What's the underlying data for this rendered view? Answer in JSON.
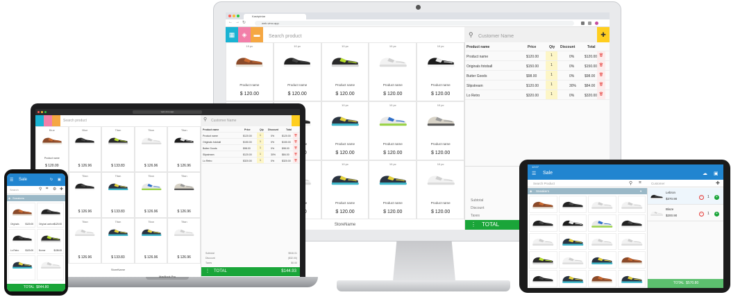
{
  "colors": {
    "green": "#1aa539",
    "cyan": "#1ab3d3",
    "pink": "#f27fa9",
    "orange": "#f5a742",
    "yellow": "#ffce1f",
    "blue": "#2185d0",
    "grey": "#f0f0f0"
  },
  "monitor": {
    "browser_tab": "Kasirpintar",
    "url": "web.vimo.app",
    "search_placeholder": "Search product",
    "customer_placeholder": "Customer Name",
    "products": [
      {
        "variants": "10 pc",
        "name": "Product name",
        "price": "$ 120.00",
        "shoe": "brown"
      },
      {
        "variants": "10 pc",
        "name": "Product name",
        "price": "$ 120.00",
        "shoe": "black"
      },
      {
        "variants": "10 pc",
        "name": "Product name",
        "price": "$ 120.00",
        "shoe": "lime"
      },
      {
        "variants": "10 pc",
        "name": "Product name",
        "price": "$ 120.00",
        "shoe": "white"
      },
      {
        "variants": "10 pc",
        "name": "Product name",
        "price": "$ 120.00",
        "shoe": "blackwhite"
      },
      {
        "variants": "10 pc",
        "name": "Product name",
        "price": "$ 120.00",
        "shoe": "brown"
      },
      {
        "variants": "10 pc",
        "name": "Product name",
        "price": "$ 120.00",
        "shoe": "black"
      },
      {
        "variants": "10 pc",
        "name": "Product name",
        "price": "$ 120.00",
        "shoe": "multi"
      },
      {
        "variants": "10 pc",
        "name": "Product name",
        "price": "$ 120.00",
        "shoe": "blue"
      },
      {
        "variants": "10 pc",
        "name": "Product name",
        "price": "$ 120.00",
        "shoe": "beige"
      },
      {
        "variants": "",
        "name": "Product name",
        "price": "$ 120.00",
        "shoe": "lime"
      },
      {
        "variants": "10 pc",
        "name": "Product name",
        "price": "$ 120.00",
        "shoe": "white"
      },
      {
        "variants": "10 pc",
        "name": "Product name",
        "price": "$ 120.00",
        "shoe": "multi"
      },
      {
        "variants": "10 pc",
        "name": "Product name",
        "price": "$ 120.00",
        "shoe": "multi"
      },
      {
        "variants": "10 pc",
        "name": "Product name",
        "price": "$ 120.00",
        "shoe": "white"
      }
    ],
    "cart_headers": [
      "Product name",
      "Price",
      "Qty",
      "Discount",
      "Total"
    ],
    "cart_rows": [
      {
        "name": "Product name",
        "price": "$120.00",
        "qty": "1",
        "discount": "0%",
        "total": "$120.00"
      },
      {
        "name": "Originals fotoball",
        "price": "$150.00",
        "qty": "1",
        "discount": "0%",
        "total": "$150.00"
      },
      {
        "name": "Butter Goods",
        "price": "$98.00",
        "qty": "1",
        "discount": "0%",
        "total": "$98.00"
      },
      {
        "name": "Slipstream",
        "price": "$120.00",
        "qty": "1",
        "discount": "30%",
        "total": "$84.00"
      },
      {
        "name": "Lo Retro",
        "price": "$320.00",
        "qty": "1",
        "discount": "0%",
        "total": "$320.00"
      }
    ],
    "subtotal_label": "Subtotal",
    "discount_label": "Discount",
    "taxes_label": "Taxes",
    "total_label": "TOTAL",
    "store_name": "StoreName"
  },
  "laptop": {
    "url": "web.vimo.app",
    "search_placeholder": "Search product",
    "customer_placeholder": "Customer Name",
    "products": [
      {
        "variants": "Blue",
        "name": "Product name",
        "price": "$ 120.00",
        "shoe": "brown"
      },
      {
        "variants": "Blue",
        "name": "",
        "price": "$ 126.96",
        "shoe": "black"
      },
      {
        "variants": "Titan",
        "name": "",
        "price": "$ 133.83",
        "shoe": "lime"
      },
      {
        "variants": "Titan",
        "name": "",
        "price": "$ 126.96",
        "shoe": "white"
      },
      {
        "variants": "Titan",
        "name": "",
        "price": "$ 126.96",
        "shoe": "blackwhite"
      },
      {
        "variants": "Titan",
        "name": "",
        "price": "$ 126.96",
        "shoe": "brown"
      },
      {
        "variants": "Titan",
        "name": "",
        "price": "$ 126.96",
        "shoe": "black"
      },
      {
        "variants": "Titan",
        "name": "",
        "price": "$ 133.83",
        "shoe": "multi"
      },
      {
        "variants": "Titan",
        "name": "",
        "price": "$ 126.96",
        "shoe": "blue"
      },
      {
        "variants": "Titan",
        "name": "",
        "price": "$ 126.96",
        "shoe": "beige"
      },
      {
        "variants": "Titan",
        "name": "",
        "price": "$ 126.96",
        "shoe": "lime"
      },
      {
        "variants": "Titan",
        "name": "",
        "price": "$ 126.96",
        "shoe": "white"
      },
      {
        "variants": "Titan",
        "name": "",
        "price": "$ 133.83",
        "shoe": "multi"
      },
      {
        "variants": "Titan",
        "name": "",
        "price": "$ 126.96",
        "shoe": "multi"
      },
      {
        "variants": "Titan",
        "name": "",
        "price": "$ 126.96",
        "shoe": "white"
      }
    ],
    "cart_headers": [
      "Product name",
      "Price",
      "Qty",
      "Discount",
      "Total"
    ],
    "cart_rows": [
      {
        "name": "Product name",
        "price": "$120.00",
        "qty": "1",
        "discount": "0%",
        "total": "$120.00"
      },
      {
        "name": "Originals fotoball",
        "price": "$150.00",
        "qty": "1",
        "discount": "0%",
        "total": "$150.00"
      },
      {
        "name": "Butter Goods",
        "price": "$98.00",
        "qty": "1",
        "discount": "0%",
        "total": "$98.00"
      },
      {
        "name": "Slipstream",
        "price": "$120.00",
        "qty": "1",
        "discount": "30%",
        "total": "$84.00"
      },
      {
        "name": "Lo Retro",
        "price": "$320.00",
        "qty": "1",
        "discount": "0%",
        "total": "$320.00"
      }
    ],
    "subtotal_label": "Subtotal",
    "subtotal_value": "$946.01",
    "discount_label": "Discount",
    "discount_value": "($32.00)",
    "taxes_label": "Taxes",
    "taxes_value": "$0.00",
    "total_label": "TOTAL",
    "total_value": "$144.93",
    "store_name": "StoreName",
    "device_label": "MacBook Pro"
  },
  "phone": {
    "title": "Sale",
    "search_placeholder": "Search",
    "category": "Sneakers",
    "products": [
      {
        "name": "Originals",
        "price": "$120.00",
        "shoe": "brown"
      },
      {
        "name": "Original carbon",
        "price": "$120.00",
        "shoe": "black"
      },
      {
        "name": "Lo Retro",
        "price": "$120.00",
        "shoe": "black"
      },
      {
        "name": "Burner",
        "price": "$135.00",
        "shoe": "lime"
      },
      {
        "name": "",
        "price": "",
        "shoe": "multi"
      },
      {
        "name": "",
        "price": "",
        "shoe": "white"
      }
    ],
    "total_label": "TOTAL",
    "total_value": "$844.80"
  },
  "tablet": {
    "time": "12:07",
    "title": "Sale",
    "search_placeholder": "Search Product",
    "customer_placeholder": "Customer",
    "category": "Sneakers",
    "shoes": [
      "brown",
      "black",
      "white",
      "white",
      "black",
      "blackwhite",
      "blue",
      "black",
      "white",
      "multi",
      "white",
      "white",
      "lime",
      "white",
      "multi",
      "brown",
      "black",
      "multi",
      "brown",
      "multi"
    ],
    "cart_items": [
      {
        "name": "Lebron",
        "price": "$370.90",
        "qty": "1",
        "shoe": "black"
      },
      {
        "name": "Blaze",
        "price": "$200.90",
        "qty": "1",
        "shoe": "white"
      }
    ],
    "total_label": "TOTAL",
    "total_value": "$570.80"
  }
}
